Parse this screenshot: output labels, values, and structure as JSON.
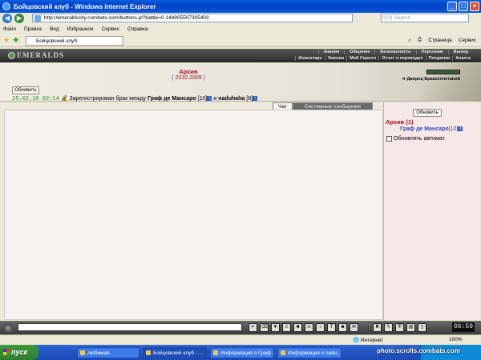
{
  "window": {
    "title": "Бойцовский клуб - Windows Internet Explorer"
  },
  "browser": {
    "address": "http://emeraldscity.combats.com/buttons.pl?battle=0.144905507305403",
    "search_placeholder": "ICQ Search",
    "menu": [
      "Файл",
      "Правка",
      "Вид",
      "Избранное",
      "Сервис",
      "Справка"
    ],
    "tab_title": "Бойцовский клуб",
    "tools": [
      "Страница",
      "Сервис"
    ]
  },
  "game": {
    "logo": "EMERALDS",
    "menu_top": [
      "Знания",
      "Общение",
      "Безопасность",
      "Персонаж",
      "Выход"
    ],
    "menu_bottom": [
      "Инвентарь",
      "Умения",
      "Мой Скролл",
      "Отчет о переводах",
      "Поединки",
      "Анкета"
    ]
  },
  "header": {
    "archive_title": "Архив",
    "archive_dates": "2010 2009",
    "refresh_label": "Обновить",
    "palace_link": "Дворец Бракосочетаний"
  },
  "log": {
    "time": "25.02.10 02:14",
    "text_before": "Зарегистрирован брак между",
    "person1": "Граф де Мансаро",
    "level1": "[10]",
    "conj": "и",
    "person2": "naduhaha",
    "level2": "[8]"
  },
  "tabs": {
    "chat": "Чат",
    "system": "Системные сообщения"
  },
  "right_panel": {
    "refresh_label": "Обновить",
    "title": "Архив (1)",
    "user": "Граф де Мансаро",
    "user_level": "[10]",
    "auto_refresh": "Обновлять автомат."
  },
  "bottom": {
    "clock": "06:59"
  },
  "status": {
    "zone": "Интернет",
    "zoom": "100%"
  },
  "taskbar": {
    "start": "пуск",
    "tasks": [
      "любимая",
      "Бойцовский клуб - ...",
      "Информация о Граф ...",
      "Информация о nadu..."
    ]
  },
  "watermark": "photo.scrolls.combats.com"
}
